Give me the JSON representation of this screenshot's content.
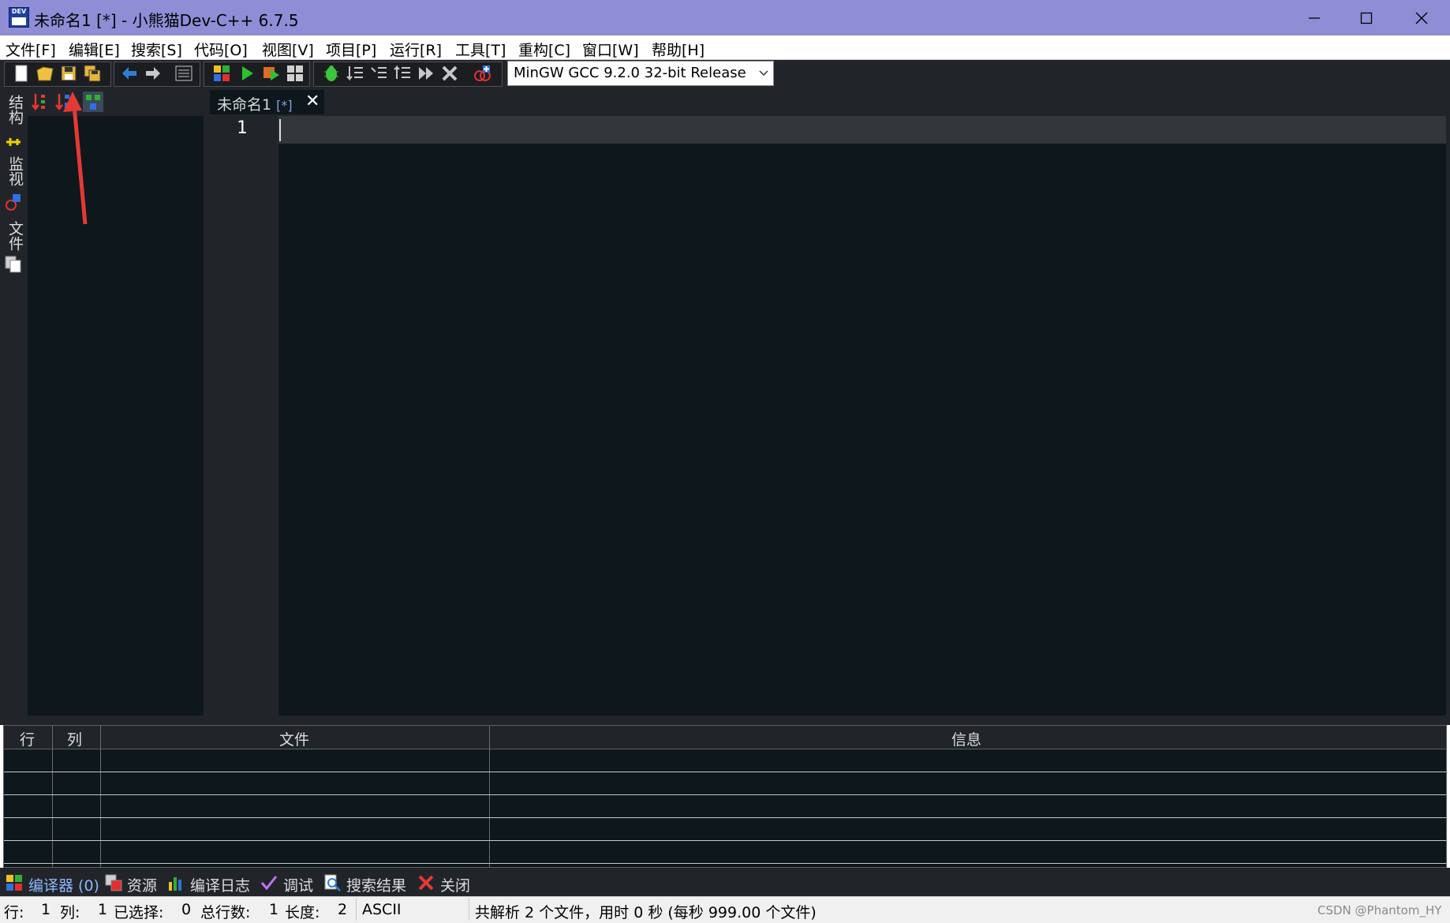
{
  "window": {
    "title": "未命名1 [*] - 小熊猫Dev-C++ 6.7.5",
    "icon_text": "DEV"
  },
  "menu": [
    "文件[F]",
    "编辑[E]",
    "搜索[S]",
    "代码[O]",
    "视图[V]",
    "项目[P]",
    "运行[R]",
    "工具[T]",
    "重构[C]",
    "窗口[W]",
    "帮助[H]"
  ],
  "toolbar": {
    "compiler_selected": "MinGW GCC 9.2.0 32-bit Release"
  },
  "side_tabs": {
    "structure": "结构",
    "watch": "监视",
    "files": "文件"
  },
  "editor": {
    "tab_label": "未命名1",
    "tab_modified": "[*]",
    "tab_close": "✕",
    "line_numbers": [
      "1"
    ]
  },
  "messages": {
    "columns": [
      "行",
      "列",
      "文件",
      "信息"
    ],
    "rows": []
  },
  "bottom_tabs": [
    "编译器 (0)",
    "资源",
    "编译日志",
    "调试",
    "搜索结果",
    "关闭"
  ],
  "status": {
    "row_label": "行:",
    "row_value": "1",
    "col_label": "列:",
    "col_value": "1",
    "sel_label": "已选择:",
    "sel_value": "0",
    "lines_label": "总行数:",
    "lines_value": "1",
    "len_label": "长度:",
    "len_value": "2",
    "encoding": "ASCII",
    "parse_info": "共解析 2 个文件，用时 0 秒 (每秒 999.00 个文件)"
  },
  "watermark": "CSDN @Phantom_HY",
  "colors": {
    "titlebar": "#8f8dd6",
    "editor_bg": "#0e171c",
    "panel_bg": "#212529",
    "current_line": "#333739",
    "arrow": "#e53935"
  }
}
